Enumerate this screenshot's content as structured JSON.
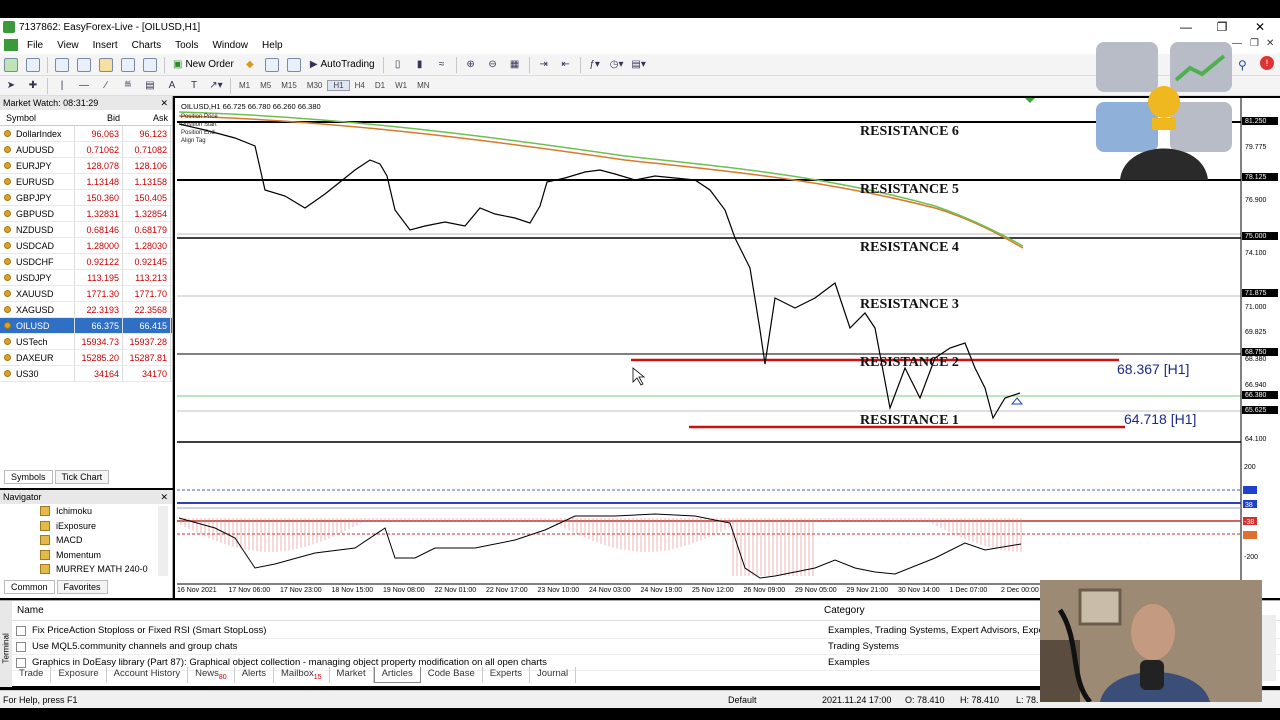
{
  "title": "7137862: EasyForex-Live - [OILUSD,H1]",
  "menu": [
    "File",
    "View",
    "Insert",
    "Charts",
    "Tools",
    "Window",
    "Help"
  ],
  "toolbar": {
    "new_order": "New Order",
    "autotrading": "AutoTrading"
  },
  "timeframes": [
    "M1",
    "M5",
    "M15",
    "M30",
    "H1",
    "H4",
    "D1",
    "W1",
    "MN"
  ],
  "market_watch": {
    "title": "Market Watch: 08:31:29",
    "columns": [
      "Symbol",
      "Bid",
      "Ask"
    ],
    "rows": [
      {
        "symbol": "DollarIndex",
        "bid": "96.063",
        "ask": "96.123"
      },
      {
        "symbol": "AUDUSD",
        "bid": "0.71062",
        "ask": "0.71082"
      },
      {
        "symbol": "EURJPY",
        "bid": "128.078",
        "ask": "128.106"
      },
      {
        "symbol": "EURUSD",
        "bid": "1.13148",
        "ask": "1.13158"
      },
      {
        "symbol": "GBPJPY",
        "bid": "150.360",
        "ask": "150.405"
      },
      {
        "symbol": "GBPUSD",
        "bid": "1.32831",
        "ask": "1.32854"
      },
      {
        "symbol": "NZDUSD",
        "bid": "0.68146",
        "ask": "0.68179"
      },
      {
        "symbol": "USDCAD",
        "bid": "1.28000",
        "ask": "1.28030"
      },
      {
        "symbol": "USDCHF",
        "bid": "0.92122",
        "ask": "0.92145"
      },
      {
        "symbol": "USDJPY",
        "bid": "113.195",
        "ask": "113.213"
      },
      {
        "symbol": "XAUUSD",
        "bid": "1771.30",
        "ask": "1771.70"
      },
      {
        "symbol": "XAGUSD",
        "bid": "22.3193",
        "ask": "22.3568"
      },
      {
        "symbol": "OILUSD",
        "bid": "66.375",
        "ask": "66.415",
        "selected": true
      },
      {
        "symbol": "USTech",
        "bid": "15934.73",
        "ask": "15937.28"
      },
      {
        "symbol": "DAXEUR",
        "bid": "15285.20",
        "ask": "15287.81"
      },
      {
        "symbol": "US30",
        "bid": "34164",
        "ask": "34170"
      }
    ],
    "tabs": [
      "Symbols",
      "Tick Chart"
    ]
  },
  "navigator": {
    "title": "Navigator",
    "items": [
      "Ichimoku",
      "iExposure",
      "MACD",
      "Momentum",
      "MURREY MATH 240-0"
    ],
    "tabs": [
      "Common",
      "Favorites"
    ]
  },
  "chart": {
    "header": "OILUSD,H1  66.725 66.780 66.260 66.380",
    "tl_labels": [
      "Position Price",
      "Position Start",
      "Position End",
      "Align Tag"
    ],
    "resistance": [
      "RESISTANCE 6",
      "RESISTANCE 5",
      "RESISTANCE 4",
      "RESISTANCE 3",
      "RESISTANCE 2",
      "RESISTANCE 1"
    ],
    "level_labels": [
      "68.367 [H1]",
      "64.718 [H1]"
    ],
    "price_scale": [
      "81.250",
      "79.775",
      "78.125",
      "76.900",
      "75.000",
      "74.100",
      "71.875",
      "71.000",
      "69.825",
      "68.750",
      "68.380",
      "66.940",
      "66.380",
      "65.625",
      "64.100"
    ],
    "indicator_scale": [
      "200",
      "-200"
    ],
    "indicator_tags": [
      "38",
      "-38"
    ],
    "time_scale": [
      "16 Nov 2021",
      "17 Nov 06:00",
      "17 Nov 23:00",
      "18 Nov 15:00",
      "19 Nov 08:00",
      "22 Nov 01:00",
      "22 Nov 17:00",
      "23 Nov 10:00",
      "24 Nov 03:00",
      "24 Nov 19:00",
      "25 Nov 12:00",
      "26 Nov 09:00",
      "29 Nov 05:00",
      "29 Nov 21:00",
      "30 Nov 14:00",
      "1 Dec 07:00",
      "2 Dec 00:00"
    ]
  },
  "terminal": {
    "columns": [
      "Name",
      "Category"
    ],
    "rows": [
      {
        "name": "Fix PriceAction Stoploss or Fixed RSI (Smart StopLoss)",
        "category": "Examples, Trading Systems, Expert Advisors, Experts"
      },
      {
        "name": "Use MQL5.community channels and group chats",
        "category": "Trading Systems"
      },
      {
        "name": "Graphics in DoEasy library (Part 87): Graphical object collection - managing object property modification on all open charts",
        "category": "Examples"
      }
    ],
    "tabs": [
      {
        "label": "Trade"
      },
      {
        "label": "Exposure"
      },
      {
        "label": "Account History"
      },
      {
        "label": "News",
        "badge": "80"
      },
      {
        "label": "Alerts"
      },
      {
        "label": "Mailbox",
        "badge": "15"
      },
      {
        "label": "Market"
      },
      {
        "label": "Articles",
        "active": true
      },
      {
        "label": "Code Base"
      },
      {
        "label": "Experts"
      },
      {
        "label": "Journal"
      }
    ],
    "side_label": "Terminal"
  },
  "status": {
    "help": "For Help, press F1",
    "profile": "Default",
    "datetime": "2021.11.24 17:00",
    "open": "O: 78.410",
    "high": "H: 78.410",
    "low": "L: 78."
  }
}
